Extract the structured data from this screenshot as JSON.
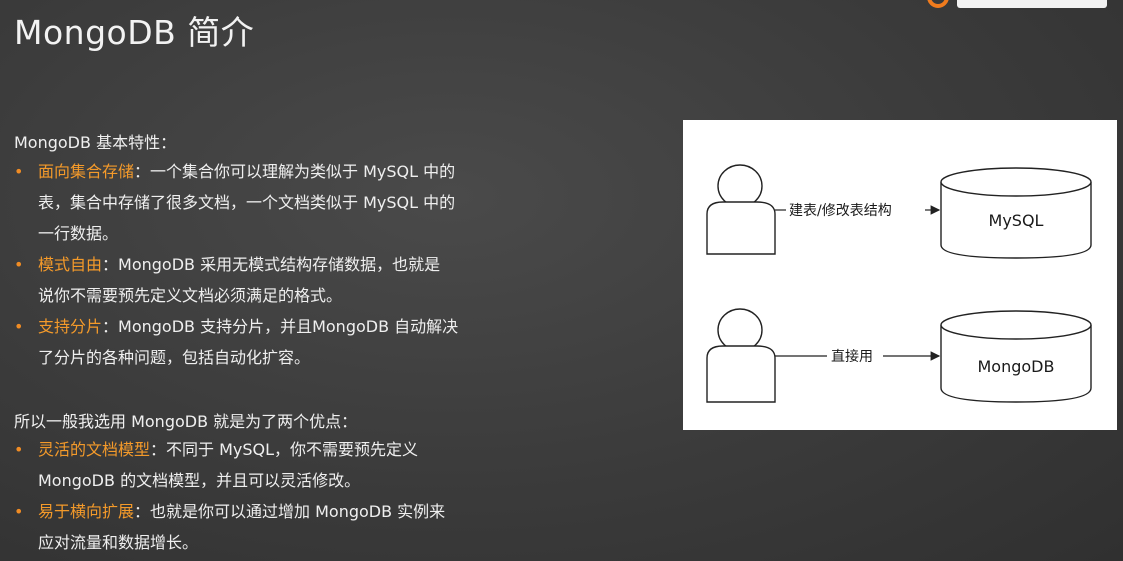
{
  "slide": {
    "title": "MongoDB 简介"
  },
  "features": {
    "heading": "MongoDB 基本特性：",
    "items": [
      {
        "highlight": "面向集合存储",
        "text": "：一个集合你可以理解为类似于 MySQL 中的",
        "text2": "表，集合中存储了很多文档，一个文档类似于 MySQL 中的",
        "text3": "一行数据。"
      },
      {
        "highlight": "模式自由",
        "text": "：MongoDB 采用无模式结构存储数据，也就是",
        "text2": "说你不需要预先定义文档必须满足的格式。"
      },
      {
        "highlight": "支持分片",
        "text": "：MongoDB 支持分片，并且MongoDB 自动解决",
        "text2": "了分片的各种问题，包括自动化扩容。"
      }
    ]
  },
  "advantages": {
    "heading": "所以一般我选用 MongoDB 就是为了两个优点：",
    "items": [
      {
        "highlight": "灵活的文档模型",
        "text": "：不同于 MySQL，你不需要预先定义",
        "text2": "MongoDB 的文档模型，并且可以灵活修改。"
      },
      {
        "highlight": "易于横向扩展",
        "text": "：也就是你可以通过增加 MongoDB 实例来",
        "text2": "应对流量和数据增长。"
      }
    ]
  },
  "diagram": {
    "top_arrow_label": "建表/修改表结构",
    "top_db_label": "MySQL",
    "bottom_arrow_label": "直接用",
    "bottom_db_label": "MongoDB"
  },
  "colors": {
    "highlight": "#f49a2a",
    "bullet": "#f08c24",
    "background": "#3b3b3b"
  }
}
